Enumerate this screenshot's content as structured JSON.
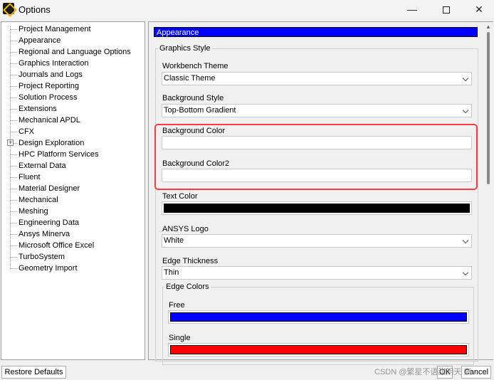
{
  "window": {
    "title": "Options",
    "minimize_glyph": "—",
    "close_glyph": "✕"
  },
  "tree": {
    "items": [
      {
        "label": "Project Management"
      },
      {
        "label": "Appearance"
      },
      {
        "label": "Regional and Language Options"
      },
      {
        "label": "Graphics Interaction"
      },
      {
        "label": "Journals and Logs"
      },
      {
        "label": "Project Reporting"
      },
      {
        "label": "Solution Process"
      },
      {
        "label": "Extensions"
      },
      {
        "label": "Mechanical APDL"
      },
      {
        "label": "CFX"
      },
      {
        "label": "Design Exploration",
        "expander": "+"
      },
      {
        "label": "HPC Platform Services"
      },
      {
        "label": "External Data"
      },
      {
        "label": "Fluent"
      },
      {
        "label": "Material Designer"
      },
      {
        "label": "Mechanical"
      },
      {
        "label": "Meshing"
      },
      {
        "label": "Engineering Data"
      },
      {
        "label": "Ansys Minerva"
      },
      {
        "label": "Microsoft Office Excel"
      },
      {
        "label": "TurboSystem"
      },
      {
        "label": "Geometry Import"
      }
    ]
  },
  "panel": {
    "section_header": "Appearance",
    "graphics_style_label": "Graphics Style",
    "workbench_theme": {
      "label": "Workbench Theme",
      "value": "Classic Theme"
    },
    "background_style": {
      "label": "Background Style",
      "value": "Top-Bottom Gradient"
    },
    "background_color": {
      "label": "Background Color",
      "value": ""
    },
    "background_color2": {
      "label": "Background Color2",
      "value": ""
    },
    "text_color": {
      "label": "Text Color",
      "color": "#000000"
    },
    "ansys_logo": {
      "label": "ANSYS Logo",
      "value": "White"
    },
    "edge_thickness": {
      "label": "Edge Thickness",
      "value": "Thin"
    },
    "edge_colors": {
      "label": "Edge Colors",
      "free": {
        "label": "Free",
        "color": "#0000ff"
      },
      "single": {
        "label": "Single",
        "color": "#ff0000"
      }
    },
    "highlight_color": "#ff3b3b",
    "header_color": "#0000ff"
  },
  "buttons": {
    "restore_defaults": "Restore Defaults",
    "ok": "OK",
    "cancel": "Cancel"
  },
  "watermark": "CSDN @繁星不语甜阴天 高..."
}
